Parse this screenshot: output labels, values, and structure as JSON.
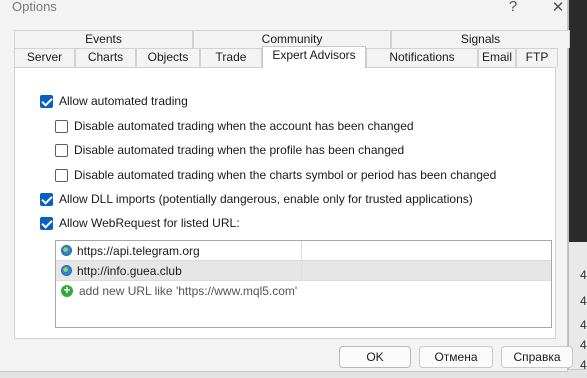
{
  "window": {
    "title": "Options",
    "help_glyph": "?",
    "close_glyph": "✕"
  },
  "tabs": {
    "row1": [
      "Events",
      "Community",
      "Signals"
    ],
    "row2": [
      "Server",
      "Charts",
      "Objects",
      "Trade",
      "Expert Advisors",
      "Notifications",
      "Email",
      "FTP"
    ],
    "active": "Expert Advisors"
  },
  "options": {
    "allow_automated_trading": {
      "label": "Allow automated trading",
      "checked": true
    },
    "disable_account_changed": {
      "label": "Disable automated trading when the account has been changed",
      "checked": false
    },
    "disable_profile_changed": {
      "label": "Disable automated trading when the profile has been changed",
      "checked": false
    },
    "disable_symbol_changed": {
      "label": "Disable automated trading when the charts symbol or period has been changed",
      "checked": false
    },
    "allow_dll_imports": {
      "label": "Allow DLL imports (potentially dangerous, enable only for trusted applications)",
      "checked": true
    },
    "allow_webrequest": {
      "label": "Allow WebRequest for listed URL:",
      "checked": true
    }
  },
  "url_list": {
    "urls": [
      "https://api.telegram.org",
      "http://info.guea.club"
    ],
    "selected_index": 1,
    "add_placeholder": "add new URL like 'https://www.mql5.com'"
  },
  "buttons": {
    "ok": "OK",
    "cancel": "Отмена",
    "help": "Справка"
  },
  "background": {
    "right_digits": [
      "4",
      "4",
      "4",
      "4",
      "4"
    ]
  },
  "colors": {
    "accent": "#0a5fc4",
    "selected_row": "#e6e6e6",
    "add_icon": "#37a93a"
  }
}
